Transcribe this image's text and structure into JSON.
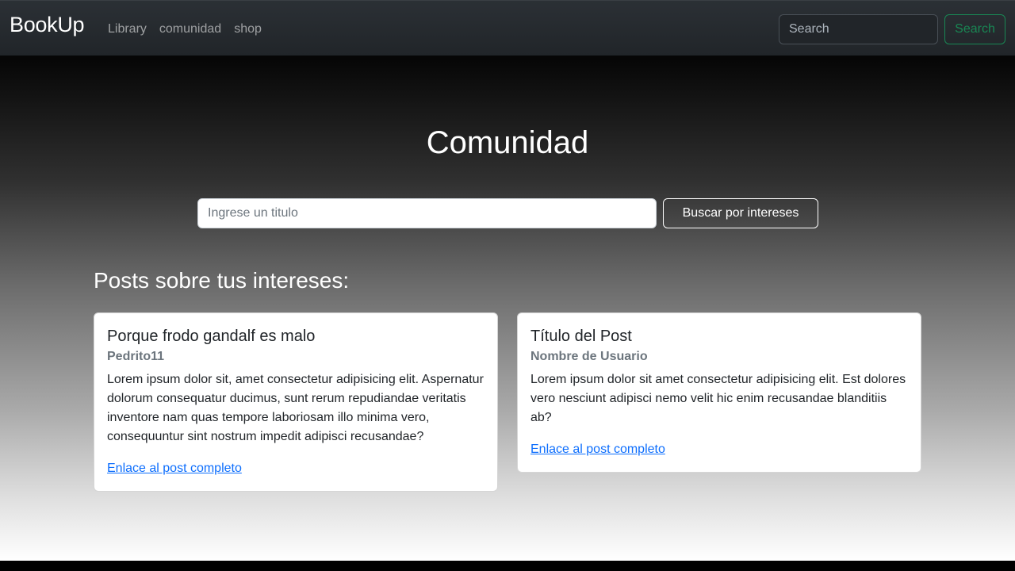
{
  "navbar": {
    "brand": "BookUp",
    "links": [
      "Library",
      "comunidad",
      "shop"
    ],
    "search_placeholder": "Search",
    "search_button": "Search"
  },
  "hero": {
    "title": "Comunidad",
    "search_placeholder": "Ingrese un titulo",
    "interest_button": "Buscar por intereses"
  },
  "section_title": "Posts sobre tus intereses:",
  "posts": [
    {
      "title": "Porque frodo gandalf es malo",
      "user": "Pedrito11",
      "text": "Lorem ipsum dolor sit, amet consectetur adipisicing elit. Aspernatur dolorum consequatur ducimus, sunt rerum repudiandae veritatis inventore nam quas tempore laboriosam illo minima vero, consequuntur sint nostrum impedit adipisci recusandae?",
      "link": "Enlace al post completo"
    },
    {
      "title": "Título del Post",
      "user": "Nombre de Usuario",
      "text": "Lorem ipsum dolor sit amet consectetur adipisicing elit. Est dolores vero nesciunt adipisci nemo velit hic enim recusandae blanditiis ab?",
      "link": "Enlace al post completo"
    }
  ],
  "colors": {
    "navbar_bg": "#212529",
    "search_button_accent": "#198754",
    "link": "#0d6efd"
  }
}
